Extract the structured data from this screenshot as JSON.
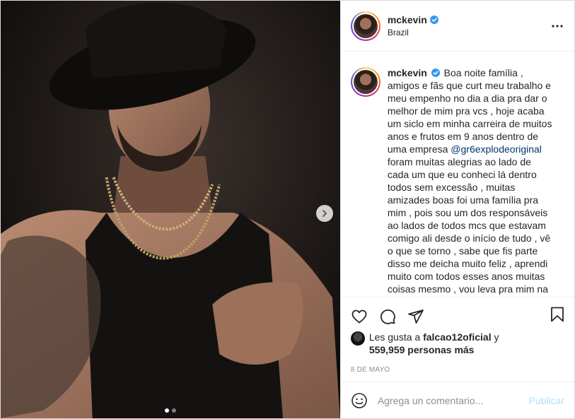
{
  "post": {
    "username": "mckevin",
    "location": "Brazil",
    "caption_segments": {
      "before_mention": "Boa noite família , amigos e fãs que curt meu trabalho e meu empenho no dia a dia pra dar o melhor de mim pra vcs , hoje acaba um siclo em minha carreira de muitos anos e frutos em 9 anos dentro de uma empresa ",
      "mention": "@gr6explodeoriginal",
      "after_mention": " foram muitas alegrias ao lado de cada um que eu conheci lá dentro todos sem excessão , muitas amizades boas foi uma família pra mim , pois sou um dos responsáveis ao lados de todos mcs que estavam comigo ali desde o início de tudo , vê o que se torno , sabe que fis parte disso me deicha muito feliz , aprendi muito com todos esses anos muitas coisas mesmo , vou leva pra mim na vida é nessa minha nova etapa , é o fim de uma saga e o"
    },
    "likes": {
      "prefix": "Les gusta a ",
      "liker": "falcao12oficial",
      "conj": " y",
      "count_text": "559,959 personas más"
    },
    "date": "8 DE MAYO",
    "comment": {
      "placeholder": "Agrega un comentario...",
      "publish_label": "Publicar"
    },
    "carousel": {
      "total": 2,
      "active_index": 0
    }
  },
  "icons": {
    "verified": "verified-badge-icon",
    "more": "more-options-icon",
    "like": "heart-icon",
    "comment": "comment-bubble-icon",
    "share": "paper-plane-icon",
    "save": "bookmark-icon",
    "emoji": "emoji-smile-icon",
    "next": "chevron-right-icon"
  },
  "colors": {
    "accent_link": "#00376b",
    "verified_blue": "#3897f0",
    "publish_disabled": "#b2dffc",
    "meta_gray": "#8e8e8e"
  }
}
